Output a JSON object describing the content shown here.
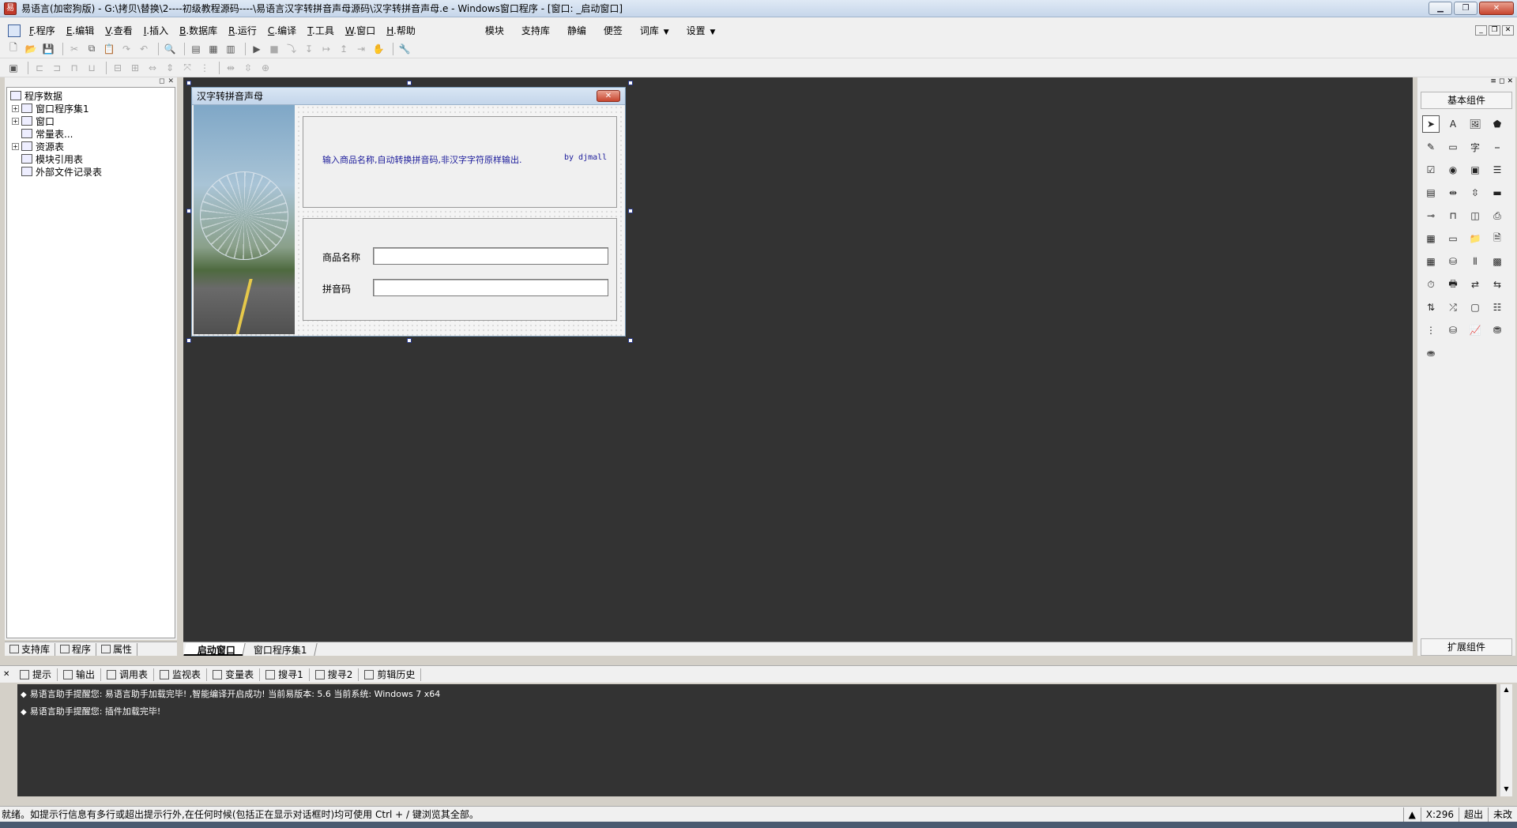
{
  "window": {
    "title": "易语言(加密狗版) - G:\\拷贝\\替换\\2----初级教程源码----\\易语言汉字转拼音声母源码\\汉字转拼音声母.e - Windows窗口程序 - [窗口: _启动窗口]",
    "app_icon": "易"
  },
  "menu": {
    "items": [
      {
        "key": "F",
        "label": ".程序"
      },
      {
        "key": "E",
        "label": ".编辑"
      },
      {
        "key": "V",
        "label": ".查看"
      },
      {
        "key": "I",
        "label": ".插入"
      },
      {
        "key": "B",
        "label": ".数据库"
      },
      {
        "key": "R",
        "label": ".运行"
      },
      {
        "key": "C",
        "label": ".编译"
      },
      {
        "key": "T",
        "label": ".工具"
      },
      {
        "key": "W",
        "label": ".窗口"
      },
      {
        "key": "H",
        "label": ".帮助"
      }
    ],
    "right_items": {
      "module": "模块",
      "support_lib": "支持库",
      "static_compile": "静编",
      "sticky": "便签",
      "thesaurus": "词库",
      "settings": "设置"
    }
  },
  "tree": {
    "root": "程序数据",
    "items": [
      "窗口程序集1",
      "窗口",
      "常量表...",
      "资源表",
      "模块引用表",
      "外部文件记录表"
    ]
  },
  "left_tabs": {
    "support": "支持库",
    "program": "程序",
    "property": "属性"
  },
  "form": {
    "title": "汉字转拼音声母",
    "description": "输入商品名称,自动转换拼音码,非汉字字符原样输出.",
    "author": "by djmall",
    "label_name": "商品名称",
    "label_pinyin": "拼音码",
    "value_name": "",
    "value_pinyin": ""
  },
  "design_tabs": {
    "startup": "_启动窗口",
    "assembly": "窗口程序集1"
  },
  "right_panel": {
    "basic": "基本组件",
    "extended": "扩展组件"
  },
  "output_tabs": {
    "hint": "提示",
    "output": "输出",
    "calls": "调用表",
    "watch": "监视表",
    "vars": "变量表",
    "search1": "搜寻1",
    "search2": "搜寻2",
    "clip_history": "剪辑历史"
  },
  "output": {
    "line1": "易语言助手提醒您: 易语言助手加载完毕!  ,智能编译开启成功!  当前易版本: 5.6  当前系统: Windows 7 x64",
    "line2": "易语言助手提醒您: 插件加载完毕!"
  },
  "status": {
    "text": "就绪。如提示行信息有多行或超出提示行外,在任何时候(包括正在显示对话框时)均可使用 Ctrl + / 键浏览其全部。",
    "coords": "X:296",
    "overflow": "超出",
    "unsaved": "未改"
  },
  "colors": {
    "design_bg": "#333333",
    "desc_text": "#1a1a9a"
  }
}
